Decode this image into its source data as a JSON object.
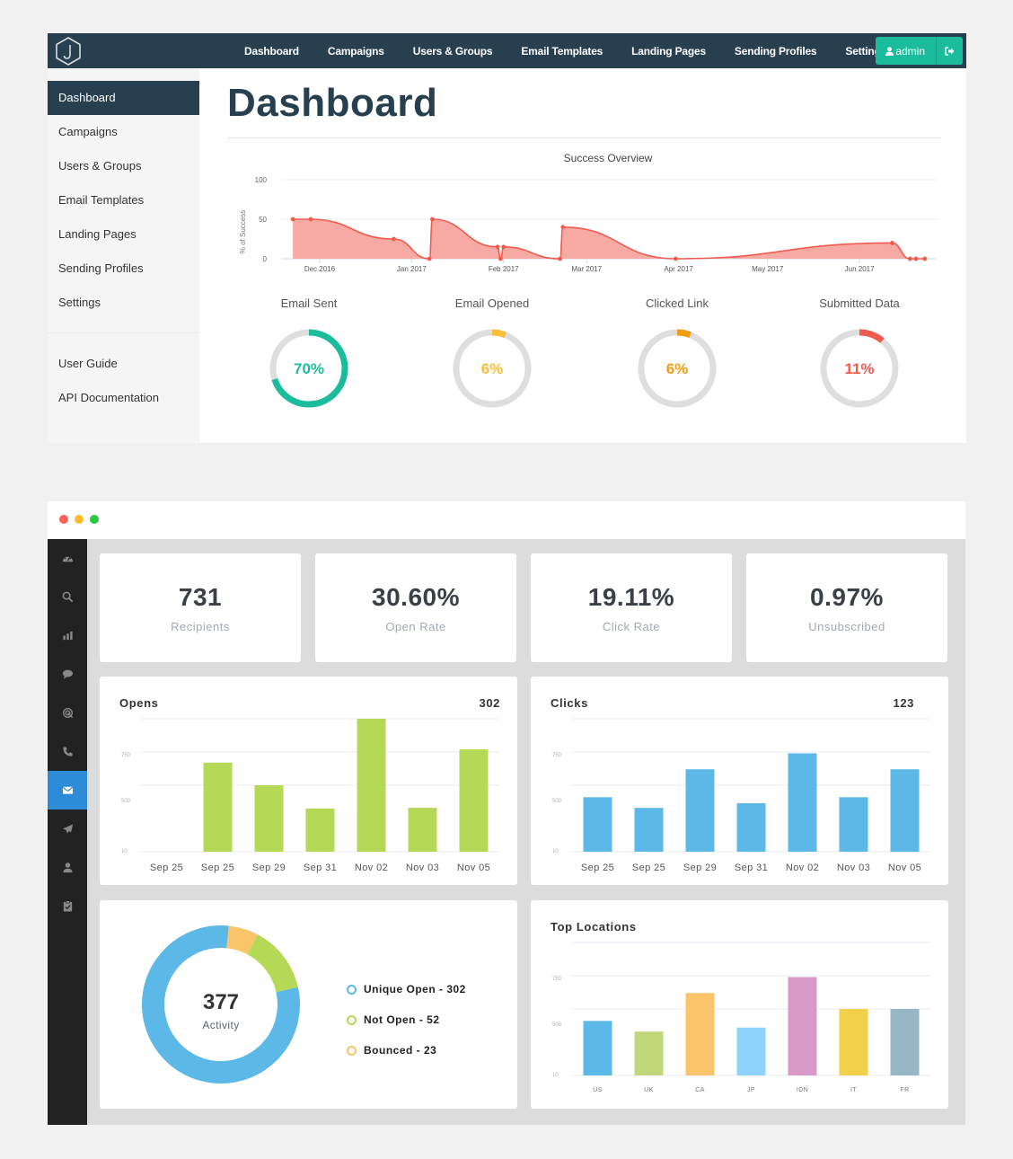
{
  "gophish": {
    "nav": {
      "links": [
        "Dashboard",
        "Campaigns",
        "Users & Groups",
        "Email Templates",
        "Landing Pages",
        "Sending Profiles",
        "Settings"
      ],
      "admin_label": "admin",
      "logout_icon": "sign-out-icon",
      "user_icon": "user-icon",
      "logo_icon": "gophish-hexagon-hook-logo"
    },
    "sidebar": {
      "items": [
        "Dashboard",
        "Campaigns",
        "Users & Groups",
        "Email Templates",
        "Landing Pages",
        "Sending Profiles",
        "Settings"
      ],
      "active": "Dashboard",
      "secondary": [
        "User Guide",
        "API Documentation"
      ]
    },
    "page_title": "Dashboard",
    "donuts": [
      {
        "label": "Email Sent",
        "value_text": "70%",
        "fraction": 0.7,
        "color": "#1abc9c"
      },
      {
        "label": "Email Opened",
        "value_text": "6%",
        "fraction": 0.06,
        "color": "#f9bf3b"
      },
      {
        "label": "Clicked Link",
        "value_text": "6%",
        "fraction": 0.06,
        "color": "#f39c12"
      },
      {
        "label": "Submitted Data",
        "value_text": "11%",
        "fraction": 0.11,
        "color": "#f05b4f"
      }
    ],
    "colors": {
      "nav_bg": "#283f50",
      "accent": "#1abc9c",
      "line": "#f05b4f",
      "area": "#f7a9a3"
    }
  },
  "analytics": {
    "window_dots": [
      "#ff5f57",
      "#febc2e",
      "#28c840"
    ],
    "sidebar_icons": [
      "dashboard-gauge-icon",
      "search-icon",
      "bar-chart-icon",
      "comment-icon",
      "target-icon",
      "phone-icon",
      "envelope-icon",
      "paper-plane-icon",
      "user-icon",
      "clipboard-check-icon"
    ],
    "active_icon_index": 6,
    "stats": [
      {
        "value": "731",
        "label": "Recipients"
      },
      {
        "value": "30.60%",
        "label": "Open Rate"
      },
      {
        "value": "19.11%",
        "label": "Click Rate"
      },
      {
        "value": "0.97%",
        "label": "Unsubscribed"
      }
    ],
    "opens": {
      "title": "Opens",
      "total": "302"
    },
    "clicks": {
      "title": "Clicks",
      "total": "123"
    },
    "activity": {
      "total": "377",
      "label": "Activity",
      "legend": [
        {
          "text": "Unique Open - 302",
          "color": "#5cb8e6"
        },
        {
          "text": "Not Open - 52",
          "color": "#b5d957"
        },
        {
          "text": "Bounced - 23",
          "color": "#f9c46a"
        }
      ]
    },
    "locations": {
      "title": "Top Locations"
    }
  },
  "chart_data": [
    {
      "type": "area",
      "title": "Success Overview",
      "xlabel": "",
      "ylabel": "% of Success",
      "ylim": [
        0,
        100
      ],
      "yticks": [
        0,
        50,
        100
      ],
      "xtick_labels": [
        "Dec 2016",
        "Jan 2017",
        "Feb 2017",
        "Mar 2017",
        "Apr 2017",
        "May 2017",
        "Jun 2017"
      ],
      "grid": true,
      "series": [
        {
          "name": "% of Success",
          "x": [
            "2016-11-22",
            "2016-11-28",
            "2016-12-26",
            "2017-01-07",
            "2017-01-08",
            "2017-01-30",
            "2017-01-31",
            "2017-02-01",
            "2017-02-20",
            "2017-02-21",
            "2017-03-31",
            "2017-06-12",
            "2017-06-18",
            "2017-06-20",
            "2017-06-23"
          ],
          "values": [
            50,
            50,
            25,
            0,
            50,
            15,
            0,
            15,
            0,
            40,
            0,
            20,
            0,
            0,
            0
          ]
        }
      ]
    },
    {
      "type": "pie",
      "title": "Email Sent",
      "values": [
        70,
        30
      ],
      "categories": [
        "Sent",
        "Remaining"
      ]
    },
    {
      "type": "pie",
      "title": "Email Opened",
      "values": [
        6,
        94
      ],
      "categories": [
        "Opened",
        "Remaining"
      ]
    },
    {
      "type": "pie",
      "title": "Clicked Link",
      "values": [
        6,
        94
      ],
      "categories": [
        "Clicked",
        "Remaining"
      ]
    },
    {
      "type": "pie",
      "title": "Submitted Data",
      "values": [
        11,
        89
      ],
      "categories": [
        "Submitted",
        "Remaining"
      ]
    },
    {
      "type": "bar",
      "title": "Opens",
      "categories": [
        "Sep 25",
        "Sep 25",
        "Sep 29",
        "Sep 31",
        "Nov 02",
        "Nov 03",
        "Nov 05"
      ],
      "values": [
        0,
        670,
        500,
        325,
        1000,
        330,
        770
      ],
      "ytick_labels": [
        "750",
        "500",
        "10"
      ],
      "ylim": [
        0,
        1000
      ],
      "color": "#b5d957"
    },
    {
      "type": "bar",
      "title": "Clicks",
      "categories": [
        "Sep 25",
        "Sep 25",
        "Sep 29",
        "Sep 31",
        "Nov 02",
        "Nov 03",
        "Nov 05"
      ],
      "values": [
        410,
        330,
        620,
        365,
        740,
        410,
        620
      ],
      "ytick_labels": [
        "750",
        "500",
        "10"
      ],
      "ylim": [
        0,
        1000
      ],
      "color": "#5cb8e6"
    },
    {
      "type": "pie",
      "title": "Activity",
      "categories": [
        "Unique Open",
        "Not Open",
        "Bounced"
      ],
      "values": [
        302,
        52,
        23
      ],
      "colors": [
        "#5cb8e6",
        "#b5d957",
        "#f9c46a"
      ]
    },
    {
      "type": "bar",
      "title": "Top Locations",
      "categories": [
        "US",
        "UK",
        "CA",
        "JP",
        "IDN",
        "IT",
        "FR"
      ],
      "values": [
        410,
        330,
        620,
        360,
        740,
        500,
        500
      ],
      "ytick_labels": [
        "750",
        "500",
        "10"
      ],
      "ylim": [
        0,
        1000
      ],
      "colors": [
        "#5cb8e6",
        "#c1d87a",
        "#f9c46a",
        "#8dd3fc",
        "#d998c8",
        "#f2d14a",
        "#97b7c7"
      ]
    }
  ]
}
